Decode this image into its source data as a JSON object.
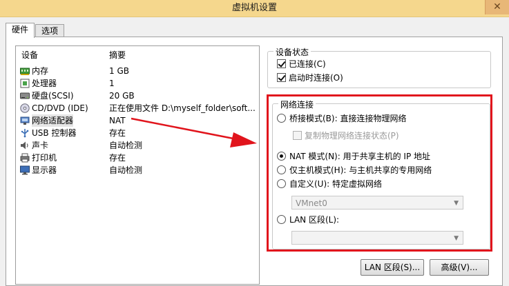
{
  "window": {
    "title": "虚拟机设置",
    "close_glyph": "✕"
  },
  "tabs": [
    {
      "label": "硬件",
      "active": true
    },
    {
      "label": "选项",
      "active": false
    }
  ],
  "device_list": {
    "headers": {
      "device": "设备",
      "summary": "摘要"
    },
    "rows": [
      {
        "icon": "memory-icon",
        "name": "内存",
        "summary": "1 GB"
      },
      {
        "icon": "processor-icon",
        "name": "处理器",
        "summary": "1"
      },
      {
        "icon": "hard-disk-icon",
        "name": "硬盘(SCSI)",
        "summary": "20 GB"
      },
      {
        "icon": "cd-dvd-icon",
        "name": "CD/DVD (IDE)",
        "summary": "正在使用文件 D:\\myself_folder\\soft..."
      },
      {
        "icon": "network-adapter-icon",
        "name": "网络适配器",
        "summary": "NAT",
        "selected": true
      },
      {
        "icon": "usb-icon",
        "name": "USB 控制器",
        "summary": "存在"
      },
      {
        "icon": "sound-card-icon",
        "name": "声卡",
        "summary": "自动检测"
      },
      {
        "icon": "printer-icon",
        "name": "打印机",
        "summary": "存在"
      },
      {
        "icon": "display-icon",
        "name": "显示器",
        "summary": "自动检测"
      }
    ]
  },
  "device_status": {
    "legend": "设备状态",
    "connected_label": "已连接(C)",
    "connected_checked": true,
    "connect_at_power_on_label": "启动时连接(O)",
    "connect_at_power_on_checked": true
  },
  "network_connection": {
    "legend": "网络连接",
    "bridged_label": "桥接模式(B): 直接连接物理网络",
    "replicate_label": "复制物理网络连接状态(P)",
    "nat_label": "NAT 模式(N): 用于共享主机的 IP 地址",
    "host_only_label": "仅主机模式(H): 与主机共享的专用网络",
    "custom_label": "自定义(U): 特定虚拟网络",
    "custom_network_value": "VMnet0",
    "lan_segment_label": "LAN 区段(L):",
    "lan_segment_value": "",
    "selected_mode": "nat"
  },
  "buttons": {
    "lan_segments": "LAN 区段(S)...",
    "advanced": "高级(V)..."
  },
  "colors": {
    "annotation_red": "#e1141c",
    "titlebar": "#f5d78d"
  }
}
